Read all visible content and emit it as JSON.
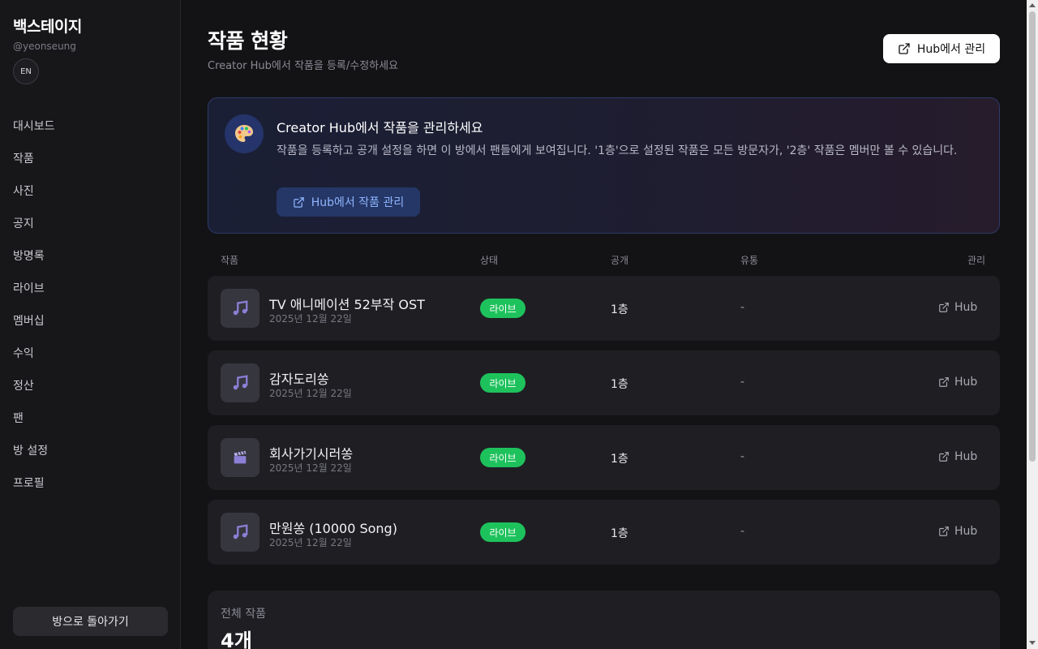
{
  "sidebar": {
    "brand": "백스테이지",
    "handle": "@yeonseung",
    "lang": "EN",
    "items": [
      {
        "label": "대시보드"
      },
      {
        "label": "작품"
      },
      {
        "label": "사진"
      },
      {
        "label": "공지"
      },
      {
        "label": "방명록"
      },
      {
        "label": "라이브"
      },
      {
        "label": "멤버십"
      },
      {
        "label": "수익"
      },
      {
        "label": "정산"
      },
      {
        "label": "팬"
      },
      {
        "label": "방 설정"
      },
      {
        "label": "프로필"
      }
    ],
    "back_label": "방으로 돌아가기"
  },
  "header": {
    "title": "작품 현황",
    "subtitle": "Creator Hub에서 작품을 등록/수정하세요",
    "hub_button": "Hub에서 관리"
  },
  "banner": {
    "icon": "palette-icon",
    "title": "Creator Hub에서 작품을 관리하세요",
    "description": "작품을 등록하고 공개 설정을 하면 이 방에서 팬들에게 보여집니다. '1층'으로 설정된 작품은 모든 방문자가, '2층' 작품은 멤버만 볼 수 있습니다.",
    "button": "Hub에서 작품 관리"
  },
  "table": {
    "headers": {
      "work": "작품",
      "status": "상태",
      "public": "공개",
      "distribution": "유통",
      "manage": "관리"
    },
    "rows": [
      {
        "title": "TV 애니메이션 52부작 OST",
        "date": "2025년 12월 22일",
        "status": "라이브",
        "public": "1층",
        "distribution": "-",
        "manage": "Hub",
        "icon": "music-note-icon"
      },
      {
        "title": "감자도리쏭",
        "date": "2025년 12월 22일",
        "status": "라이브",
        "public": "1층",
        "distribution": "-",
        "manage": "Hub",
        "icon": "music-note-icon"
      },
      {
        "title": "회사가기시러쏭",
        "date": "2025년 12월 22일",
        "status": "라이브",
        "public": "1층",
        "distribution": "-",
        "manage": "Hub",
        "icon": "clapperboard-icon"
      },
      {
        "title": "만원쏭 (10000 Song)",
        "date": "2025년 12월 22일",
        "status": "라이브",
        "public": "1층",
        "distribution": "-",
        "manage": "Hub",
        "icon": "music-note-icon"
      }
    ]
  },
  "summary": {
    "label": "전체 작품",
    "value": "4개"
  },
  "colors": {
    "background": "#131316",
    "card": "#1f1f23",
    "live_badge": "#1ec25c",
    "banner_border": "#2f3a66",
    "banner_button_text": "#8fb5ff"
  }
}
